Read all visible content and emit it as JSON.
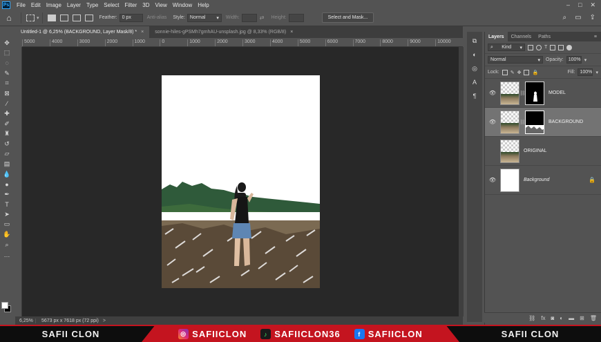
{
  "menubar": {
    "logo": "Ps",
    "items": [
      "File",
      "Edit",
      "Image",
      "Layer",
      "Type",
      "Select",
      "Filter",
      "3D",
      "View",
      "Window",
      "Help"
    ]
  },
  "options": {
    "feather_label": "Feather:",
    "feather_value": "0 px",
    "antialias_label": "Anti-alias",
    "style_label": "Style:",
    "style_value": "Normal",
    "width_label": "Width:",
    "height_label": "Height:",
    "select_mask_label": "Select and Mask..."
  },
  "tabs": [
    {
      "label": "Untitled-1 @ 6,25% (BACKGROUND, Layer Mask/8) *",
      "close": "×"
    },
    {
      "label": "sonnie-hiles-gPSMh7gmhAU-unsplash.jpg @ 8,33% (RGB/8)",
      "close": "×"
    }
  ],
  "ruler": {
    "ticks": [
      "5000",
      "4000",
      "3000",
      "2000",
      "1000",
      "0",
      "1000",
      "2000",
      "3000",
      "4000",
      "5000",
      "6000",
      "7000",
      "8000",
      "9000",
      "10000"
    ]
  },
  "status": {
    "zoom": "6,25%",
    "info": "5673 px x 7618 px (72 ppi)",
    "arrow": ">"
  },
  "layers_panel": {
    "tabs": [
      "Layers",
      "Channels",
      "Paths"
    ],
    "kind_label": "Kind",
    "blend_mode": "Normal",
    "opacity_label": "Opacity:",
    "opacity_value": "100%",
    "lock_label": "Lock:",
    "fill_label": "Fill:",
    "fill_value": "100%",
    "layers": [
      {
        "name": "MODEL",
        "visible": true,
        "has_mask": true,
        "selected": false
      },
      {
        "name": "BACKGROUND",
        "visible": true,
        "has_mask": true,
        "selected": true
      },
      {
        "name": "ORIGINAL",
        "visible": false,
        "has_mask": false,
        "selected": false
      },
      {
        "name": "Background",
        "visible": true,
        "has_mask": false,
        "selected": false,
        "locked": true
      }
    ]
  },
  "banner": {
    "left": "SAFII CLON",
    "instagram": "SAFIICLON",
    "tiktok": "SAFIICLON36",
    "facebook": "SAFIICLON",
    "right": "SAFII CLON",
    "accent": "#c4141f"
  }
}
